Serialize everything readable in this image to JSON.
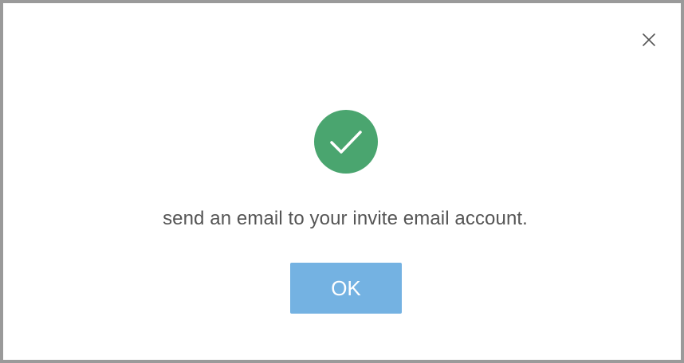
{
  "dialog": {
    "close_icon": "close-icon",
    "status_icon": "check-circle-icon",
    "message": "send an email to your invite email account.",
    "ok_label": "OK"
  },
  "colors": {
    "success": "#4aa56f",
    "primary_button": "#74b2e2",
    "border": "#9a9a9a",
    "text": "#555555"
  }
}
